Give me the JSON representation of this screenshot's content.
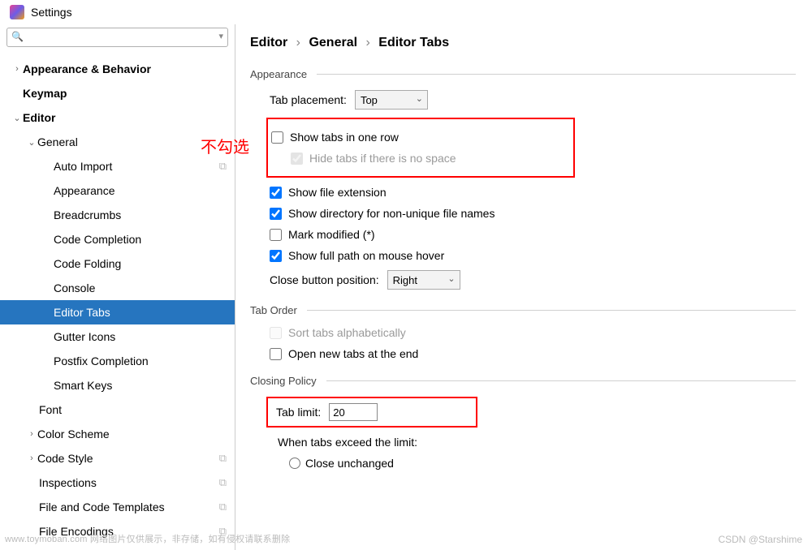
{
  "window": {
    "title": "Settings"
  },
  "search": {
    "placeholder": ""
  },
  "tree": {
    "appearance_behavior": "Appearance & Behavior",
    "keymap": "Keymap",
    "editor": "Editor",
    "general": "General",
    "auto_import": "Auto Import",
    "appearance": "Appearance",
    "breadcrumbs": "Breadcrumbs",
    "code_completion": "Code Completion",
    "code_folding": "Code Folding",
    "console": "Console",
    "editor_tabs": "Editor Tabs",
    "gutter_icons": "Gutter Icons",
    "postfix_completion": "Postfix Completion",
    "smart_keys": "Smart Keys",
    "font": "Font",
    "color_scheme": "Color Scheme",
    "code_style": "Code Style",
    "inspections": "Inspections",
    "file_code_templates": "File and Code Templates",
    "file_encodings": "File Encodings"
  },
  "breadcrumb": {
    "p1": "Editor",
    "p2": "General",
    "p3": "Editor Tabs"
  },
  "sections": {
    "appearance": "Appearance",
    "tab_order": "Tab Order",
    "closing_policy": "Closing Policy"
  },
  "labels": {
    "tab_placement": "Tab placement:",
    "close_button_pos": "Close button position:",
    "tab_limit": "Tab limit:",
    "when_exceed": "When tabs exceed the limit:"
  },
  "options": {
    "tab_placement": "Top",
    "close_button_pos": "Right"
  },
  "checkboxes": {
    "show_one_row": "Show tabs in one row",
    "hide_no_space": "Hide tabs if there is no space",
    "show_ext": "Show file extension",
    "show_dir": "Show directory for non-unique file names",
    "mark_modified": "Mark modified (*)",
    "show_full_path": "Show full path on mouse hover",
    "sort_alpha": "Sort tabs alphabetically",
    "open_end": "Open new tabs at the end"
  },
  "radios": {
    "close_unchanged": "Close unchanged"
  },
  "values": {
    "tab_limit": "20"
  },
  "annotations": {
    "red_note": "不勾选"
  },
  "watermarks": {
    "left": "www.toymoban.com 网络图片仅供展示，非存储，如有侵权请联系删除",
    "right": "CSDN @Starshime"
  }
}
